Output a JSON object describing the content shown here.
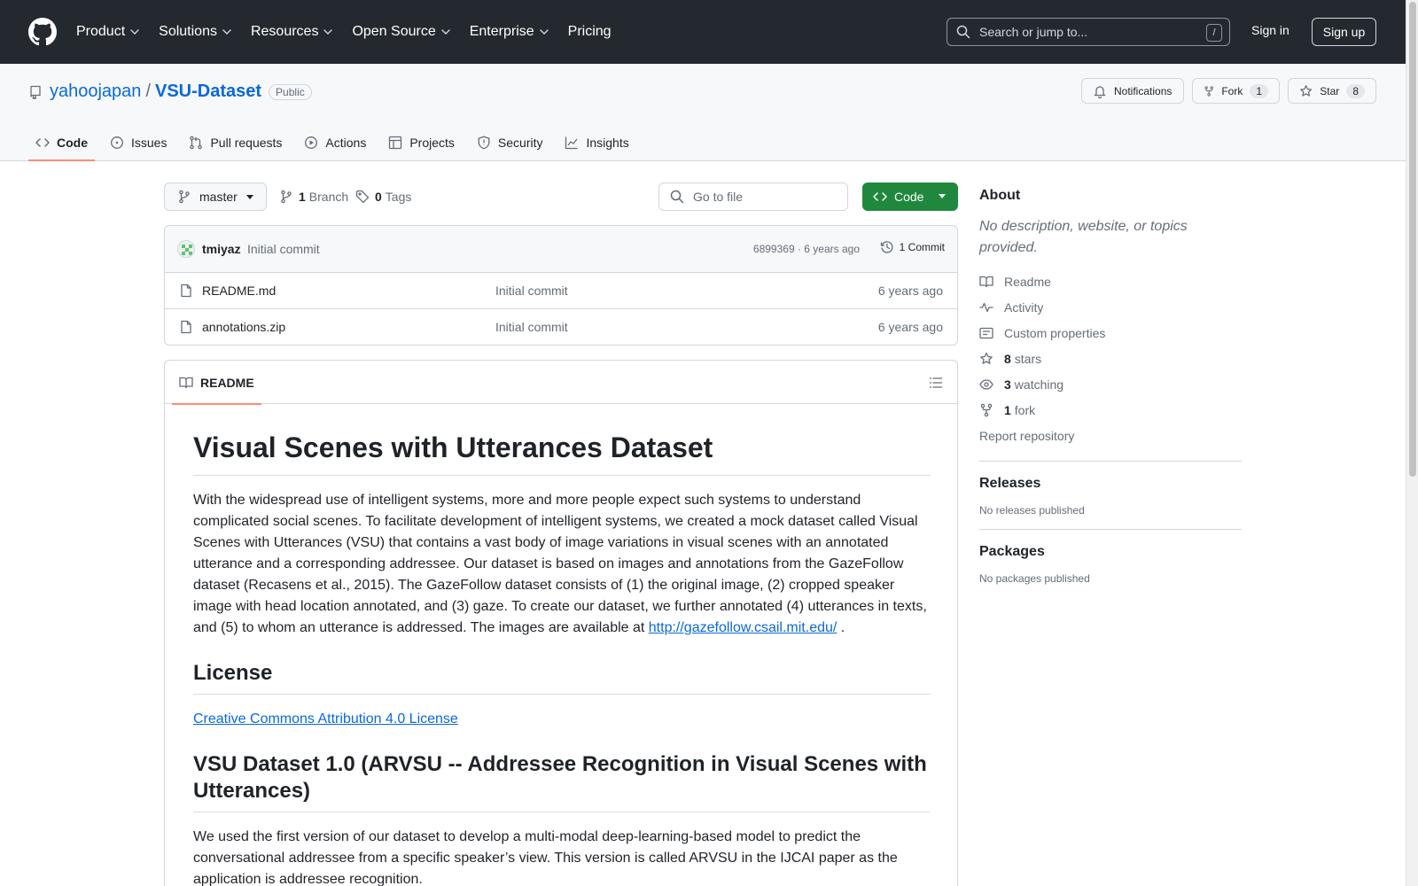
{
  "header": {
    "nav": [
      {
        "label": "Product",
        "dropdown": true
      },
      {
        "label": "Solutions",
        "dropdown": true
      },
      {
        "label": "Resources",
        "dropdown": true
      },
      {
        "label": "Open Source",
        "dropdown": true
      },
      {
        "label": "Enterprise",
        "dropdown": true
      },
      {
        "label": "Pricing",
        "dropdown": false
      }
    ],
    "search_placeholder": "Search or jump to...",
    "search_key": "/",
    "sign_in": "Sign in",
    "sign_up": "Sign up"
  },
  "repo": {
    "owner": "yahoojapan",
    "separator": "/",
    "name": "VSU-Dataset",
    "visibility": "Public",
    "notifications_label": "Notifications",
    "fork_label": "Fork",
    "fork_count": "1",
    "star_label": "Star",
    "star_count": "8"
  },
  "tabs": [
    {
      "label": "Code",
      "icon": "code-icon",
      "selected": true
    },
    {
      "label": "Issues",
      "icon": "issue-icon",
      "selected": false
    },
    {
      "label": "Pull requests",
      "icon": "pull-request-icon",
      "selected": false
    },
    {
      "label": "Actions",
      "icon": "play-icon",
      "selected": false
    },
    {
      "label": "Projects",
      "icon": "table-icon",
      "selected": false
    },
    {
      "label": "Security",
      "icon": "shield-icon",
      "selected": false
    },
    {
      "label": "Insights",
      "icon": "graph-icon",
      "selected": false
    }
  ],
  "browser": {
    "branch": "master",
    "branch_count": "1",
    "branch_label": "Branch",
    "tag_count": "0",
    "tag_label": "Tags",
    "goto_file": "Go to file",
    "code_button": "Code"
  },
  "commit": {
    "author": "tmiyaz",
    "message": "Initial commit",
    "meta": "6899369 · 6 years ago",
    "commits_label": "1 Commit"
  },
  "files": [
    {
      "name": "README.md",
      "message": "Initial commit",
      "time": "6 years ago"
    },
    {
      "name": "annotations.zip",
      "message": "Initial commit",
      "time": "6 years ago"
    }
  ],
  "readme": {
    "tab_label": "README",
    "h1": "Visual Scenes with Utterances Dataset",
    "p1": "With the widespread use of intelligent systems, more and more people expect such systems to understand complicated social scenes. To facilitate development of intelligent systems, we created a mock dataset called Visual Scenes with Utterances (VSU) that contains a vast body of image variations in visual scenes with an annotated utterance and a corresponding addressee. Our dataset is based on images and annotations from the GazeFollow dataset (Recasens et al., 2015). The GazeFollow dataset consists of (1) the original image, (2) cropped speaker image with head location annotated, and (3) gaze. To create our dataset, we further annotated (4) utterances in texts, and (5) to whom an utterance is addressed. The images are available at",
    "p1_link": "http://gazefollow.csail.mit.edu/",
    "p1_end": " .",
    "h2_license": "License",
    "license_link": "Creative Commons Attribution 4.0 License",
    "h2_dataset": "VSU Dataset 1.0 (ARVSU -- Addressee Recognition in Visual Scenes with Utterances)",
    "p2": "We used the first version of our dataset to develop a multi-modal deep-learning-based model to predict the conversational addressee from a specific speaker’s view. This version is called ARVSU in the IJCAI paper as the application is addressee recognition."
  },
  "about": {
    "title": "About",
    "description": "No description, website, or topics provided.",
    "items": [
      {
        "icon": "book-icon",
        "count": "",
        "label": "Readme"
      },
      {
        "icon": "pulse-icon",
        "count": "",
        "label": "Activity"
      },
      {
        "icon": "note-icon",
        "count": "",
        "label": "Custom properties"
      },
      {
        "icon": "star-icon",
        "count": "8",
        "label": "stars"
      },
      {
        "icon": "eye-icon",
        "count": "3",
        "label": "watching"
      },
      {
        "icon": "fork-icon",
        "count": "1",
        "label": "fork"
      }
    ],
    "report": "Report repository",
    "releases_title": "Releases",
    "releases_text": "No releases published",
    "packages_title": "Packages",
    "packages_text": "No packages published"
  }
}
